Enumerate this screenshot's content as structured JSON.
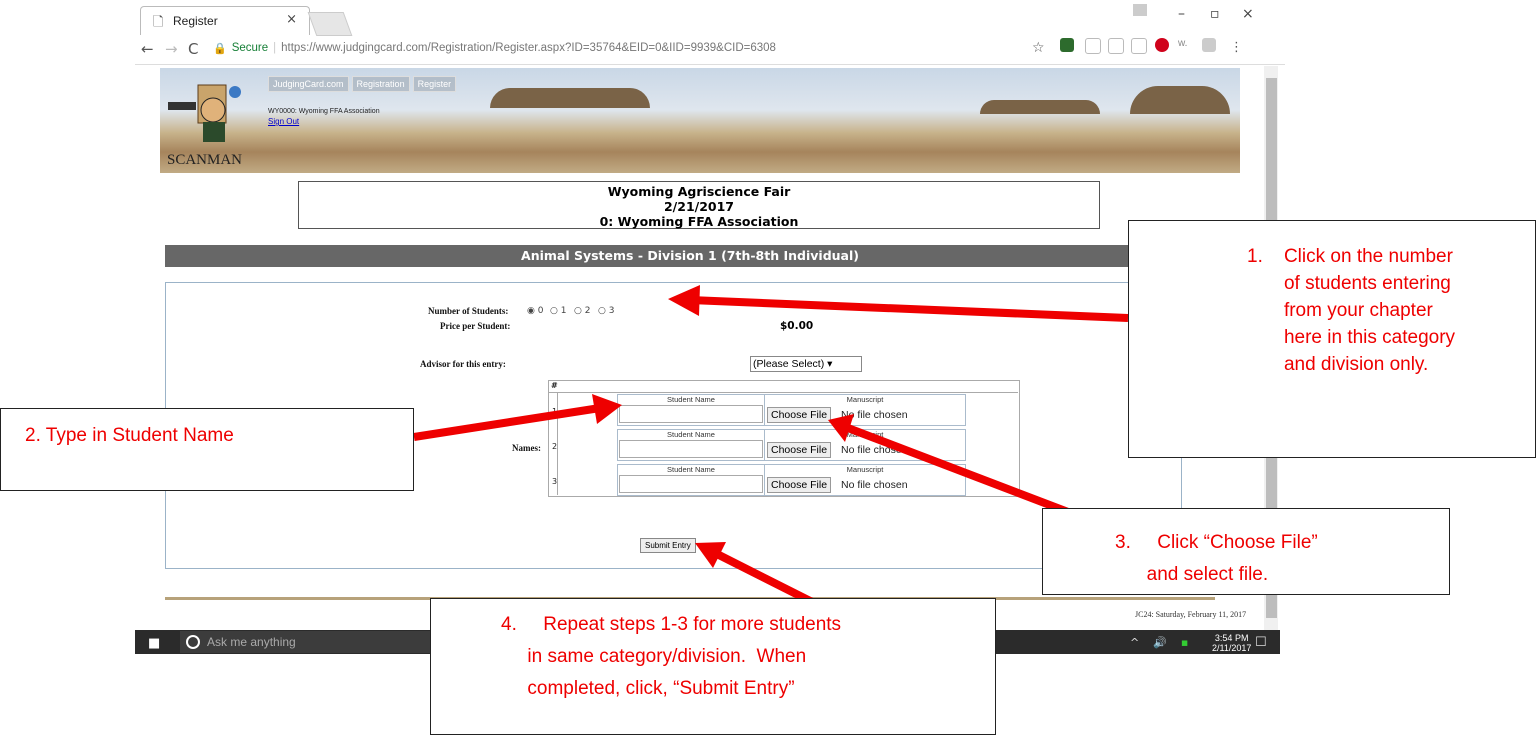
{
  "browser": {
    "tab_title": "Register",
    "secure_label": "Secure",
    "url": "https://www.judgingcard.com/Registration/Register.aspx?ID=35764&EID=0&IID=9939&CID=6308"
  },
  "header": {
    "nav_buttons": [
      "JudgingCard.com",
      "Registration",
      "Register"
    ],
    "org_line": "WY0000: Wyoming FFA Association",
    "signout": "Sign Out",
    "logo_text": "SCANMAN"
  },
  "event": {
    "name": "Wyoming Agriscience Fair",
    "date": "2/21/2017",
    "org": "0: Wyoming FFA Association"
  },
  "section": {
    "title": "Animal Systems - Division 1 (7th-8th Individual)"
  },
  "form": {
    "num_students_label": "Number of Students:",
    "num_options": [
      "0",
      "1",
      "2",
      "3"
    ],
    "selected_option": "0",
    "price_label": "Price per Student:",
    "price_value": "$0.00",
    "advisor_label": "Advisor for this entry:",
    "advisor_selected": "(Please Select)",
    "names_label": "Names:",
    "grid_header": "#",
    "rows": [
      {
        "num": "1",
        "student_label": "Student Name",
        "manuscript_label": "Manuscript",
        "choose": "Choose File",
        "file_status": "No file chosen"
      },
      {
        "num": "2",
        "student_label": "Student Name",
        "manuscript_label": "Manuscript",
        "choose": "Choose File",
        "file_status": "No file chosen"
      },
      {
        "num": "3",
        "student_label": "Student Name",
        "manuscript_label": "Manuscript",
        "choose": "Choose File",
        "file_status": "No file chosen"
      }
    ],
    "submit_label": "Submit Entry"
  },
  "footer": {
    "date_text": "JC24: Saturday, February 11, 2017"
  },
  "taskbar": {
    "search_placeholder": "Ask me anything",
    "time": "3:54 PM",
    "date": "2/11/2017"
  },
  "callouts": {
    "c1": "1.    Click on the number\n       of students entering\n       from your chapter\n       here in this category\n       and division only.",
    "c2": "2.  Type in Student Name",
    "c3": "3.     Click “Choose File”\n      and select file.",
    "c4": "4.     Repeat steps 1-3 for more students\n     in same category/division.  When\n     completed, click, “Submit Entry”"
  },
  "colors": {
    "callout_text": "#e00000",
    "arrow": "#ee0000",
    "section_bar": "#676767"
  }
}
